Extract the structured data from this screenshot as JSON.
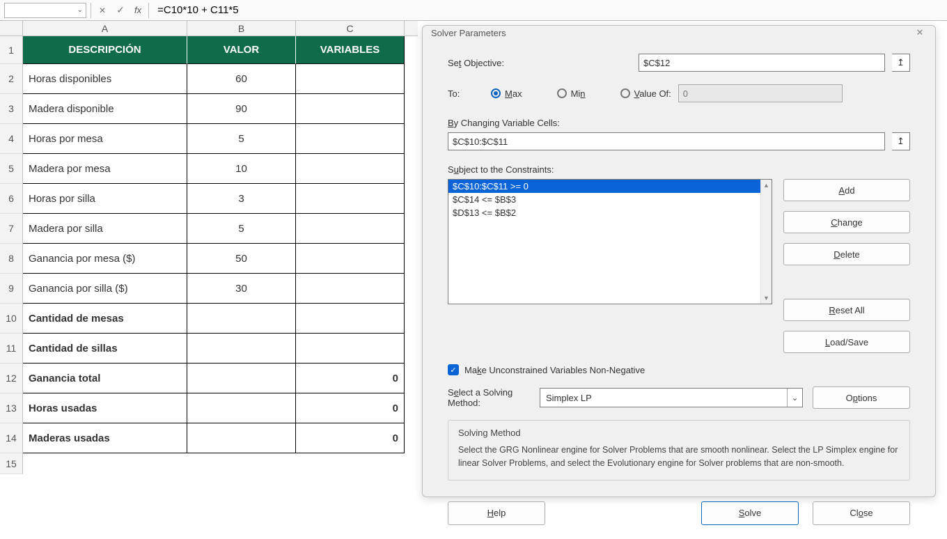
{
  "formula_bar": {
    "name_box": "",
    "formula": "=C10*10 + C11*5"
  },
  "columns": {
    "a": "A",
    "b": "B",
    "c": "C"
  },
  "header": {
    "desc": "DESCRIPCIÓN",
    "valor": "VALOR",
    "vars": "VARIABLES"
  },
  "rows": [
    {
      "n": "1"
    },
    {
      "n": "2",
      "a": "Horas disponibles",
      "b": "60",
      "c": ""
    },
    {
      "n": "3",
      "a": "Madera disponible",
      "b": "90",
      "c": ""
    },
    {
      "n": "4",
      "a": "Horas por mesa",
      "b": "5",
      "c": ""
    },
    {
      "n": "5",
      "a": "Madera por mesa",
      "b": "10",
      "c": ""
    },
    {
      "n": "6",
      "a": "Horas por silla",
      "b": "3",
      "c": ""
    },
    {
      "n": "7",
      "a": "Madera por silla",
      "b": "5",
      "c": ""
    },
    {
      "n": "8",
      "a": "Ganancia por mesa ($)",
      "b": "50",
      "c": ""
    },
    {
      "n": "9",
      "a": "Ganancia por silla ($)",
      "b": "30",
      "c": ""
    },
    {
      "n": "10",
      "a": "Cantidad de mesas",
      "b": "",
      "c": "",
      "bold": true
    },
    {
      "n": "11",
      "a": "Cantidad de sillas",
      "b": "",
      "c": "",
      "bold": true
    },
    {
      "n": "12",
      "a": "Ganancia total",
      "b": "",
      "c": "0",
      "bold": true
    },
    {
      "n": "13",
      "a": "Horas usadas",
      "b": "",
      "c": "0",
      "bold": true
    },
    {
      "n": "14",
      "a": "Maderas usadas",
      "b": "",
      "c": "0",
      "bold": true
    },
    {
      "n": "15",
      "a": "",
      "b": "",
      "c": ""
    }
  ],
  "solver": {
    "title": "Solver Parameters",
    "set_objective_label": "Set Objective:",
    "set_objective": "$C$12",
    "to_label": "To:",
    "max": "Max",
    "min": "Min",
    "valueof": "Value Of:",
    "valueof_value": "0",
    "by_changing_label": "By Changing Variable Cells:",
    "by_changing": "$C$10:$C$11",
    "constraints_label": "Subject to the Constraints:",
    "constraints": [
      "$C$10:$C$11 >= 0",
      "$C$14 <= $B$3",
      "$D$13 <= $B$2"
    ],
    "btn_add": "Add",
    "btn_change": "Change",
    "btn_delete": "Delete",
    "btn_reset": "Reset All",
    "btn_loadsave": "Load/Save",
    "make_nn": "Make Unconstrained Variables Non-Negative",
    "select_method_label": "Select a Solving Method:",
    "method": "Simplex LP",
    "btn_options": "Options",
    "box_title": "Solving Method",
    "box_text": "Select the GRG Nonlinear engine for Solver Problems that are smooth nonlinear. Select the LP Simplex engine for linear Solver Problems, and select the Evolutionary engine for Solver problems that are non-smooth.",
    "help": "Help",
    "solve": "Solve",
    "close": "Close"
  }
}
